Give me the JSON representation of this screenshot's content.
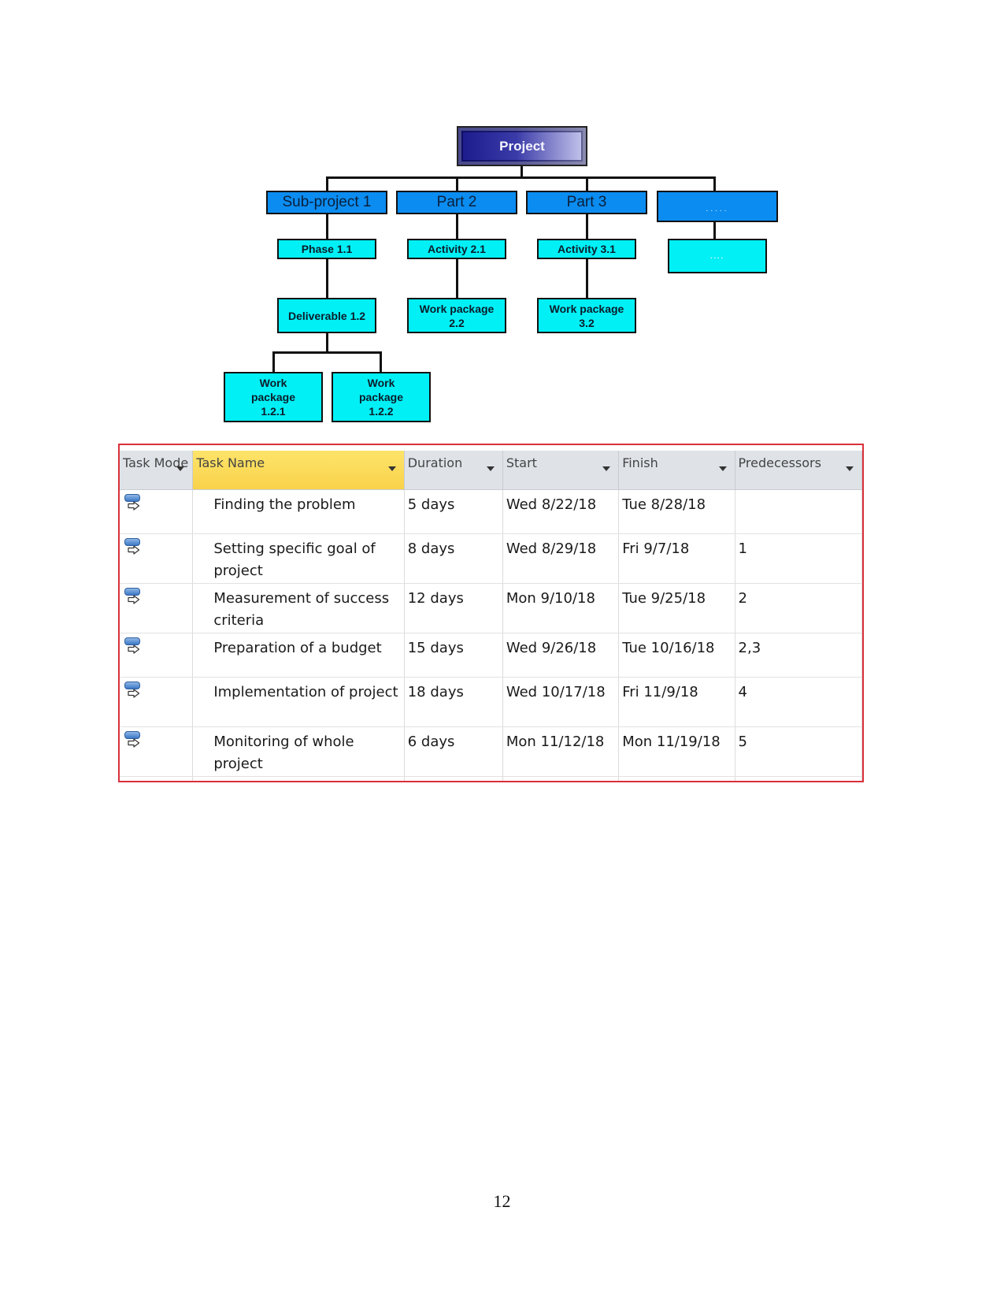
{
  "wbs": {
    "root": "Project",
    "level1": [
      "Sub-project 1",
      "Part 2",
      "Part 3",
      "....."
    ],
    "level2": [
      "Phase 1.1",
      "Activity 2.1",
      "Activity 3.1",
      "...."
    ],
    "level3": [
      "Deliverable 1.2",
      "Work package 2.2",
      "Work package 3.2"
    ],
    "level4": [
      "Work package 1.2.1",
      "Work package 1.2.2"
    ],
    "colors": {
      "root": "#1a1a8c",
      "level1": "#0b8cf0",
      "lower": "#00f0f6"
    }
  },
  "table": {
    "border_color": "#d9303a",
    "selected_header_color": "#f9d24a",
    "headers": [
      "Task Mode",
      "Task Name",
      "Duration",
      "Start",
      "Finish",
      "Predecessors"
    ],
    "rows": [
      {
        "mode_icon": "auto-scheduled-task-icon",
        "name": "Finding the problem",
        "duration": "5 days",
        "start": "Wed 8/22/18",
        "finish": "Tue 8/28/18",
        "predecessors": ""
      },
      {
        "mode_icon": "auto-scheduled-task-icon",
        "name": "Setting specific goal of project",
        "duration": "8 days",
        "start": "Wed 8/29/18",
        "finish": "Fri 9/7/18",
        "predecessors": "1"
      },
      {
        "mode_icon": "auto-scheduled-task-icon",
        "name": "Measurement of success criteria",
        "duration": "12 days",
        "start": "Mon 9/10/18",
        "finish": "Tue 9/25/18",
        "predecessors": "2"
      },
      {
        "mode_icon": "auto-scheduled-task-icon",
        "name": "Preparation of a budget",
        "duration": "15 days",
        "start": "Wed 9/26/18",
        "finish": "Tue 10/16/18",
        "predecessors": "2,3"
      },
      {
        "mode_icon": "auto-scheduled-task-icon",
        "name": "Implementation of project",
        "duration": "18 days",
        "start": "Wed 10/17/18",
        "finish": "Fri 11/9/18",
        "predecessors": "4"
      },
      {
        "mode_icon": "auto-scheduled-task-icon",
        "name": "Monitoring of whole project",
        "duration": "6 days",
        "start": "Mon 11/12/18",
        "finish": "Mon 11/19/18",
        "predecessors": "5"
      }
    ]
  },
  "page_number": "12"
}
